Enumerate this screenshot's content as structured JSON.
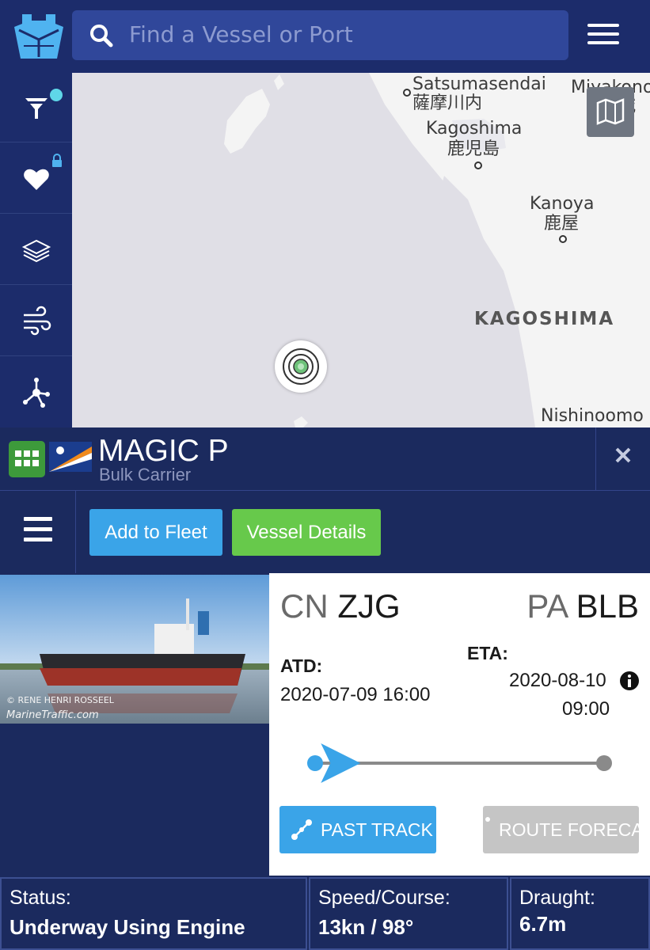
{
  "header": {
    "search_placeholder": "Find a Vessel or Port"
  },
  "sidebar": {
    "items": [
      {
        "icon": "filter-icon",
        "badge": "notification-dot"
      },
      {
        "icon": "heart-icon",
        "badge": "lock-icon"
      },
      {
        "icon": "layers-icon"
      },
      {
        "icon": "wind-icon"
      },
      {
        "icon": "network-icon"
      }
    ]
  },
  "map": {
    "places": [
      {
        "name": "Satsumasendai",
        "jp": "薩摩川内"
      },
      {
        "name": "Kagoshima",
        "jp": "鹿児島"
      },
      {
        "name": "Kanoya",
        "jp": "鹿屋"
      },
      {
        "name": "Miyakono",
        "jp": "城"
      },
      {
        "name": "Nishinoomo"
      }
    ],
    "region_label": "KAGOSHIMA"
  },
  "vessel": {
    "name": "MAGIC P",
    "type": "Bulk Carrier",
    "flag": "Marshall Islands"
  },
  "actions": {
    "add_to_fleet": "Add to Fleet",
    "vessel_details": "Vessel Details"
  },
  "photo": {
    "credit": "© RENE HENRI ROSSEEL",
    "site": "MarineTraffic.com"
  },
  "voyage": {
    "departure": {
      "country": "CN",
      "port": "ZJG"
    },
    "arrival": {
      "country": "PA",
      "port": "BLB"
    },
    "atd_label": "ATD:",
    "atd_value": "2020-07-09 16:00",
    "eta_label": "ETA:",
    "eta_date": "2020-08-10",
    "eta_time": "09:00",
    "progress": 0.02,
    "past_track": "PAST TRACK",
    "route_forecast": "ROUTE FORECAST"
  },
  "status": {
    "status_label": "Status:",
    "status_value": "Underway Using Engine",
    "speed_label": "Speed/Course:",
    "speed_value": "13kn / 98°",
    "draught_label": "Draught:",
    "draught_value": "6.7m"
  },
  "colors": {
    "navy": "#1b2a5e",
    "search_bg": "#30479a",
    "blue_button": "#3aa4e8",
    "green_button": "#67c94b"
  }
}
